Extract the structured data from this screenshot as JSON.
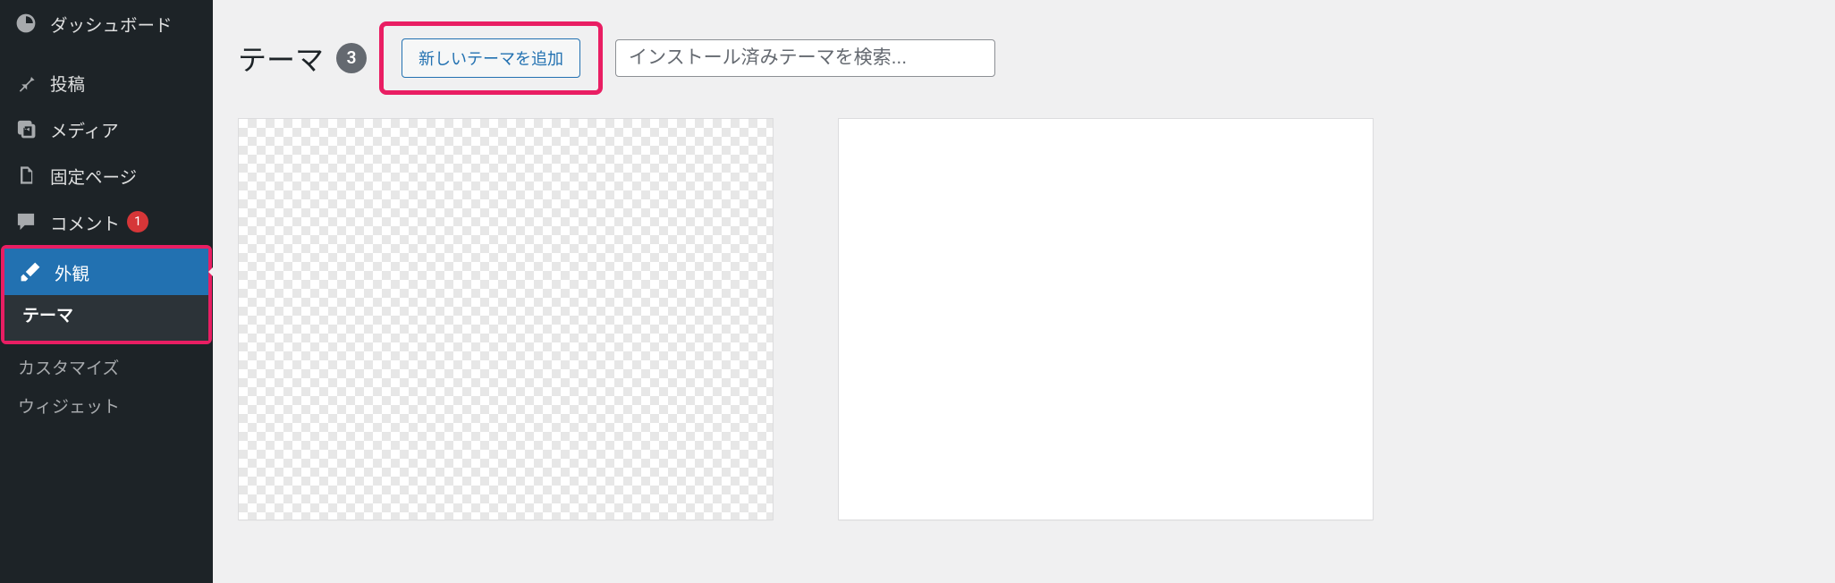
{
  "sidebar": {
    "items": [
      {
        "label": "ダッシュボード"
      },
      {
        "label": "投稿"
      },
      {
        "label": "メディア"
      },
      {
        "label": "固定ページ"
      },
      {
        "label": "コメント",
        "badge": "1"
      },
      {
        "label": "外観"
      }
    ],
    "submenu": [
      {
        "label": "テーマ"
      },
      {
        "label": "カスタマイズ"
      },
      {
        "label": "ウィジェット"
      }
    ]
  },
  "header": {
    "title": "テーマ",
    "count": "3",
    "add_label": "新しいテーマを追加",
    "search_placeholder": "インストール済みテーマを検索..."
  }
}
